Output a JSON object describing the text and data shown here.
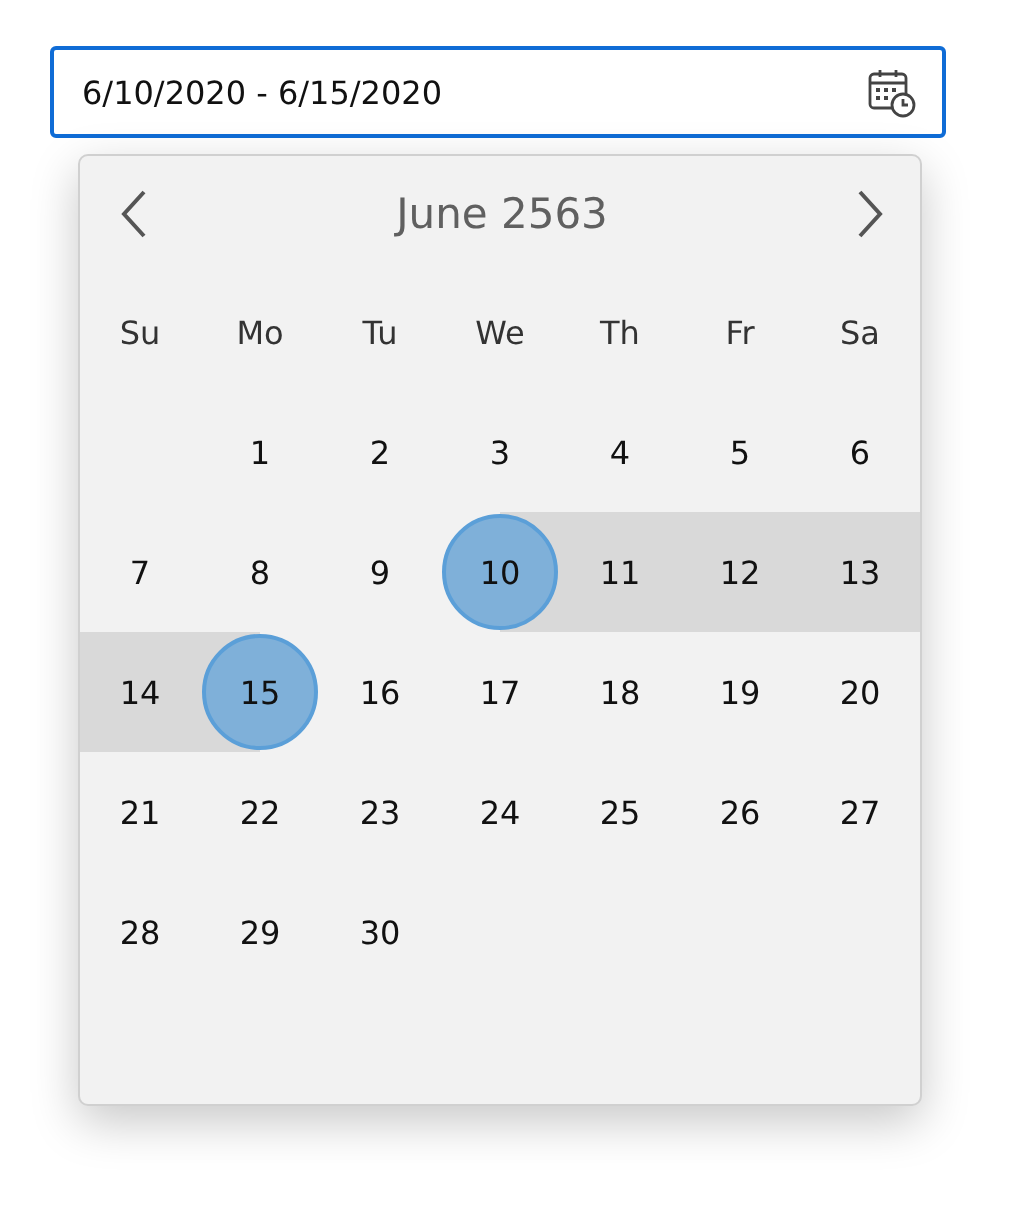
{
  "date_field": {
    "value": "6/10/2020 - 6/15/2020",
    "focused": true
  },
  "calendar": {
    "month_title": "June 2563",
    "weekdays": [
      "Su",
      "Mo",
      "Tu",
      "We",
      "Th",
      "Fr",
      "Sa"
    ],
    "weeks": [
      [
        {
          "kind": "empty"
        },
        {
          "kind": "day",
          "day": "1",
          "selected": false,
          "in_range": false
        },
        {
          "kind": "day",
          "day": "2",
          "selected": false,
          "in_range": false
        },
        {
          "kind": "day",
          "day": "3",
          "selected": false,
          "in_range": false
        },
        {
          "kind": "day",
          "day": "4",
          "selected": false,
          "in_range": false
        },
        {
          "kind": "day",
          "day": "5",
          "selected": false,
          "in_range": false
        },
        {
          "kind": "day",
          "day": "6",
          "selected": false,
          "in_range": false
        }
      ],
      [
        {
          "kind": "day",
          "day": "7",
          "selected": false,
          "in_range": false
        },
        {
          "kind": "day",
          "day": "8",
          "selected": false,
          "in_range": false
        },
        {
          "kind": "day",
          "day": "9",
          "selected": false,
          "in_range": false
        },
        {
          "kind": "day",
          "day": "10",
          "selected": true,
          "in_range": true
        },
        {
          "kind": "day",
          "day": "11",
          "selected": false,
          "in_range": true
        },
        {
          "kind": "day",
          "day": "12",
          "selected": false,
          "in_range": true
        },
        {
          "kind": "day",
          "day": "13",
          "selected": false,
          "in_range": true
        }
      ],
      [
        {
          "kind": "day",
          "day": "14",
          "selected": false,
          "in_range": true
        },
        {
          "kind": "day",
          "day": "15",
          "selected": true,
          "in_range": true
        },
        {
          "kind": "day",
          "day": "16",
          "selected": false,
          "in_range": false
        },
        {
          "kind": "day",
          "day": "17",
          "selected": false,
          "in_range": false
        },
        {
          "kind": "day",
          "day": "18",
          "selected": false,
          "in_range": false
        },
        {
          "kind": "day",
          "day": "19",
          "selected": false,
          "in_range": false
        },
        {
          "kind": "day",
          "day": "20",
          "selected": false,
          "in_range": false
        }
      ],
      [
        {
          "kind": "day",
          "day": "21",
          "selected": false,
          "in_range": false
        },
        {
          "kind": "day",
          "day": "22",
          "selected": false,
          "in_range": false
        },
        {
          "kind": "day",
          "day": "23",
          "selected": false,
          "in_range": false
        },
        {
          "kind": "day",
          "day": "24",
          "selected": false,
          "in_range": false
        },
        {
          "kind": "day",
          "day": "25",
          "selected": false,
          "in_range": false
        },
        {
          "kind": "day",
          "day": "26",
          "selected": false,
          "in_range": false
        },
        {
          "kind": "day",
          "day": "27",
          "selected": false,
          "in_range": false
        }
      ],
      [
        {
          "kind": "day",
          "day": "28",
          "selected": false,
          "in_range": false
        },
        {
          "kind": "day",
          "day": "29",
          "selected": false,
          "in_range": false
        },
        {
          "kind": "day",
          "day": "30",
          "selected": false,
          "in_range": false
        }
      ]
    ]
  }
}
